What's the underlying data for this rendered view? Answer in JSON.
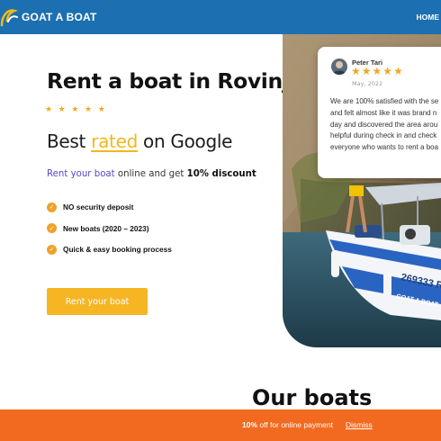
{
  "header": {
    "logo_text": "GOAT A BOAT",
    "logo_icon": "goat-horn-icon",
    "nav_home": "HOME",
    "brand_color": "#1c6fb0"
  },
  "hero": {
    "title": "Rent a boat in Rovinj",
    "rating_stars": 5,
    "best_prefix": "Best ",
    "best_rated": "rated",
    "best_suffix": " on Google",
    "discount_link": "Rent your boat",
    "discount_mid": " online and get ",
    "discount_value": "10% discount",
    "features": [
      "NO security deposit",
      "New boats (2020 – 2023)",
      "Quick & easy booking process"
    ],
    "cta_label": "Rent your boat",
    "accent_color": "#f6b623"
  },
  "review": {
    "name": "Peter Tari",
    "stars": 5,
    "date": "May, 2022",
    "lines": [
      "We are 100% satisfied with the se",
      "and felt almost like it was brand n",
      "day and discovered the area arou",
      "helpful during check in and check",
      "everyone who wants to rent a boa"
    ]
  },
  "boat_photo": {
    "hull_text_1": "269333 R",
    "hull_text_2": "GOAT A BOAT"
  },
  "section": {
    "title": "Our boats"
  },
  "promo": {
    "discount": "10%",
    "text": " off for online payment",
    "dismiss": "Dismiss",
    "bar_color": "#f26a1f"
  }
}
